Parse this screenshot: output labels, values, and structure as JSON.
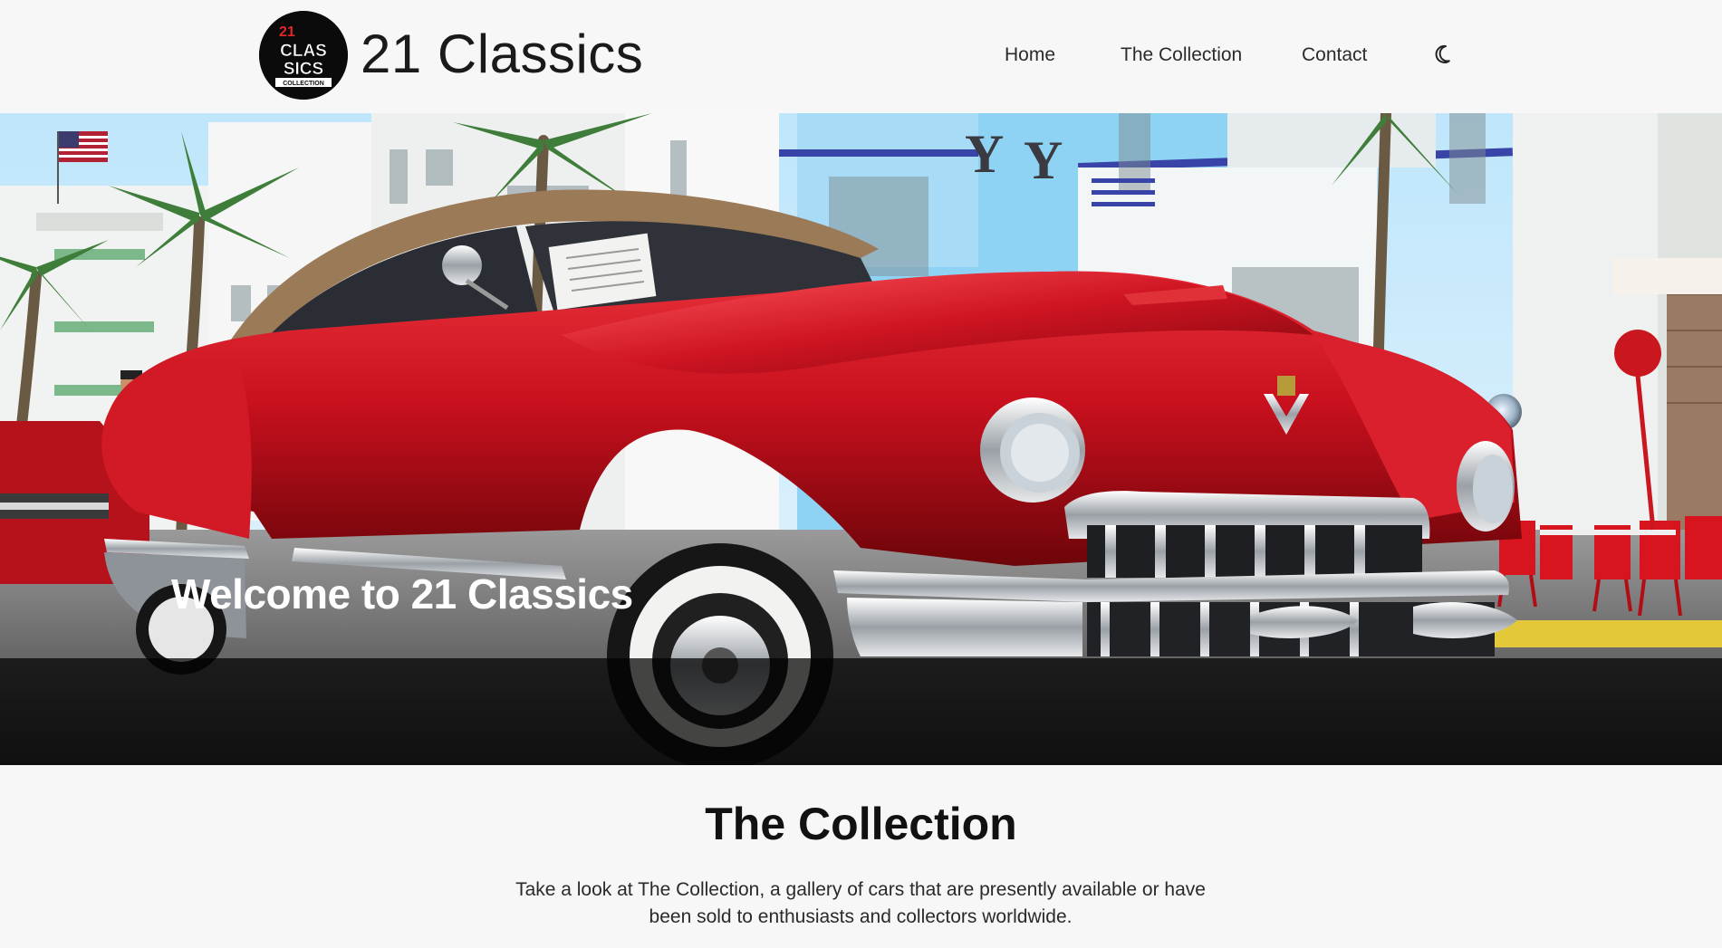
{
  "header": {
    "logo_text_top": "21",
    "logo_text_mid1": "CLAS",
    "logo_text_mid2": "SICS",
    "logo_text_bottom": "COLLECTION",
    "brand": "21 Classics",
    "nav": [
      {
        "label": "Home"
      },
      {
        "label": "The Collection"
      },
      {
        "label": "Contact"
      }
    ],
    "theme_icon": "moon-icon"
  },
  "hero": {
    "title": "Welcome to 21 Classics"
  },
  "collection": {
    "title": "The Collection",
    "description": "Take a look at The Collection, a gallery of cars that are presently available or have been sold to enthusiasts and collectors worldwide."
  },
  "colors": {
    "background": "#f7f7f7",
    "car_red": "#c8101e",
    "building_blue": "#8fd3f4",
    "caption_overlay": "#000000"
  }
}
